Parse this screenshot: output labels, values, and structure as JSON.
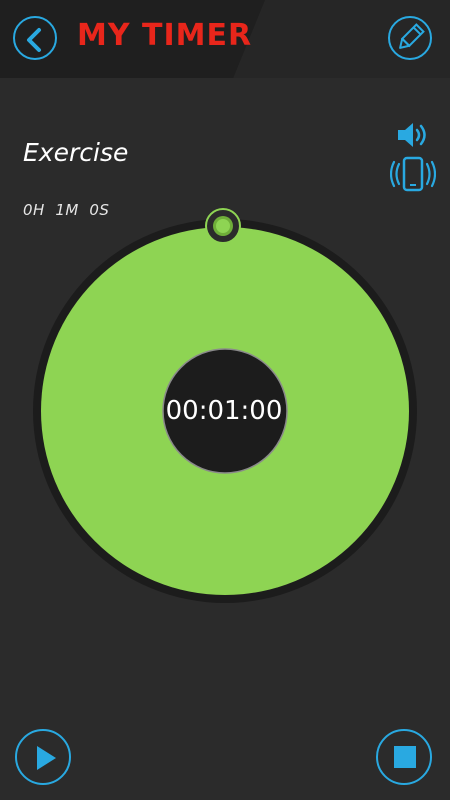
{
  "header": {
    "title": "MY TIMER",
    "back_icon": "chevron-left-icon",
    "edit_icon": "pencil-icon"
  },
  "timer": {
    "name": "Exercise",
    "duration_text": "0H  1M  0S",
    "time_display": "00:01:00"
  },
  "alerts": {
    "sound_icon": "speaker-icon",
    "vibrate_icon": "phone-vibrate-icon"
  },
  "controls": {
    "play_icon": "play-icon",
    "stop_icon": "stop-icon"
  },
  "colors": {
    "accent": "#29a9e1",
    "title_red": "#e8261b",
    "dial_green": "#8ed453",
    "background": "#2b2b2b"
  }
}
